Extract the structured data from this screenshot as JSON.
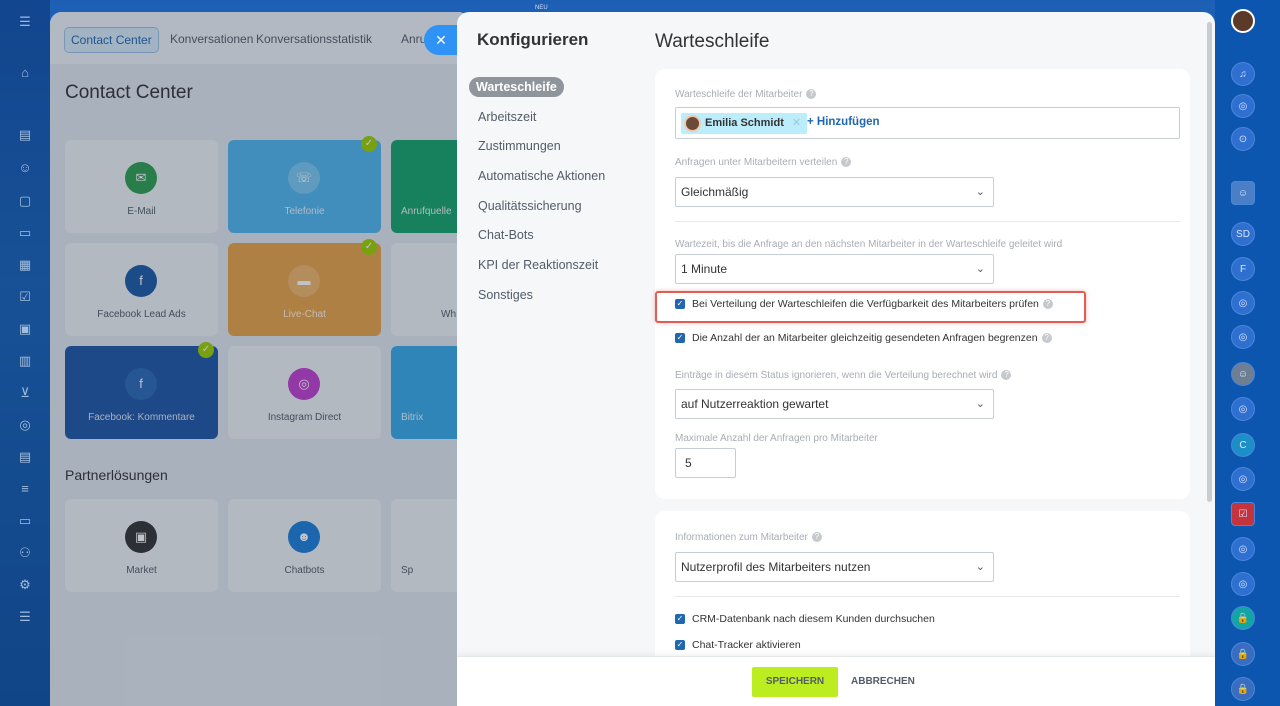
{
  "background": {
    "tabs": [
      "Contact Center",
      "Konversationen",
      "Konversationsstatistik",
      "Anru"
    ],
    "title": "Contact Center",
    "tiles": [
      "E-Mail",
      "Telefonie",
      "Anrufquelle",
      "Facebook Lead Ads",
      "Live-Chat",
      "Wh",
      "Facebook: Kommentare",
      "Instagram Direct",
      "Bitrix"
    ],
    "partner_title": "Partnerlösungen",
    "partner_tiles": [
      "Market",
      "Chatbots",
      "Sp"
    ],
    "top_badge": "NEU"
  },
  "slider": {
    "heading": "Konfigurieren",
    "page_title": "Warteschleife",
    "nav": [
      "Warteschleife",
      "Arbeitszeit",
      "Zustimmungen",
      "Automatische Aktionen",
      "Qualitätssicherung",
      "Chat-Bots",
      "KPI der Reaktionszeit",
      "Sonstiges"
    ],
    "queue_label": "Warteschleife der Mitarbeiter",
    "user_chip": "Emilia Schmidt",
    "add_link": "+ Hinzufügen",
    "distribute_label": "Anfragen unter Mitarbeitern verteilen",
    "distribute_value": "Gleichmäßig",
    "wait_label": "Wartezeit, bis die Anfrage an den nächsten Mitarbeiter in der Warteschleife geleitet wird",
    "wait_value": "1 Minute",
    "check_availability": "Bei Verteilung der Warteschleifen die Verfügbarkeit des Mitarbeiters prüfen",
    "check_limit": "Die Anzahl der an Mitarbeiter gleichzeitig gesendeten Anfragen begrenzen",
    "ignore_label": "Einträge in diesem Status ignorieren, wenn die Verteilung berechnet wird",
    "ignore_value": "auf Nutzerreaktion gewartet",
    "max_label": "Maximale Anzahl der Anfragen pro Mitarbeiter",
    "max_value": "5",
    "info_label": "Informationen zum Mitarbeiter",
    "info_value": "Nutzerprofil des Mitarbeiters nutzen",
    "check_crm": "CRM-Datenbank nach diesem Kunden durchsuchen",
    "check_tracker": "Chat-Tracker aktivieren",
    "save": "SPEICHERN",
    "cancel": "ABBRECHEN"
  },
  "colors": {
    "accent": "#2067b0",
    "save": "#bbed21",
    "highlight": "#e15d53"
  }
}
